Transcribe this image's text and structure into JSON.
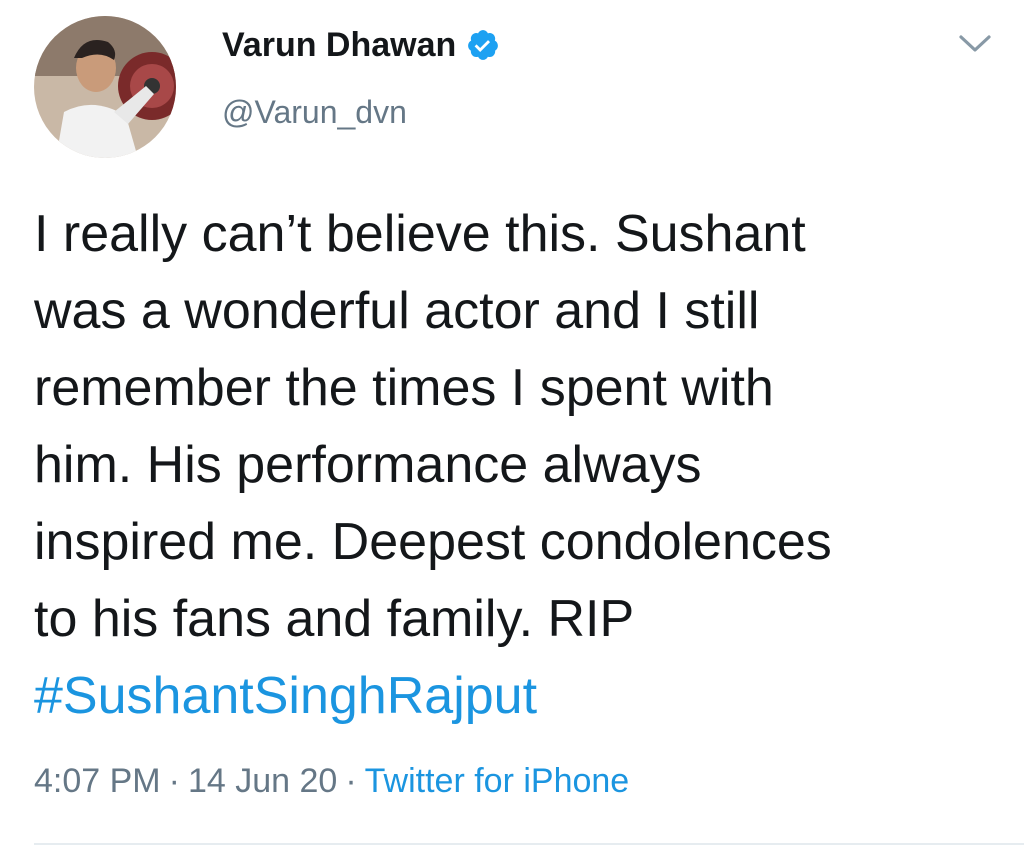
{
  "user": {
    "display_name": "Varun Dhawan",
    "handle": "@Varun_dvn",
    "verified": true,
    "avatar": "profile-photo"
  },
  "tweet": {
    "lines": [
      "I really can’t believe this. Sushant",
      "was a wonderful actor and I still",
      "remember the times I spent with",
      "him. His performance always",
      "inspired me. Deepest condolences",
      "to his fans and family. RIP"
    ],
    "hashtag": "#SushantSinghRajput"
  },
  "meta": {
    "time": "4:07 PM",
    "separator": "·",
    "date": "14 Jun 20",
    "source": "Twitter for iPhone"
  },
  "icons": {
    "verified": "verified-badge-icon",
    "menu": "chevron-down-icon"
  },
  "colors": {
    "link": "#1b95e0",
    "secondary_text": "#657786",
    "primary_text": "#14171a",
    "divider": "#e6ecf0"
  }
}
